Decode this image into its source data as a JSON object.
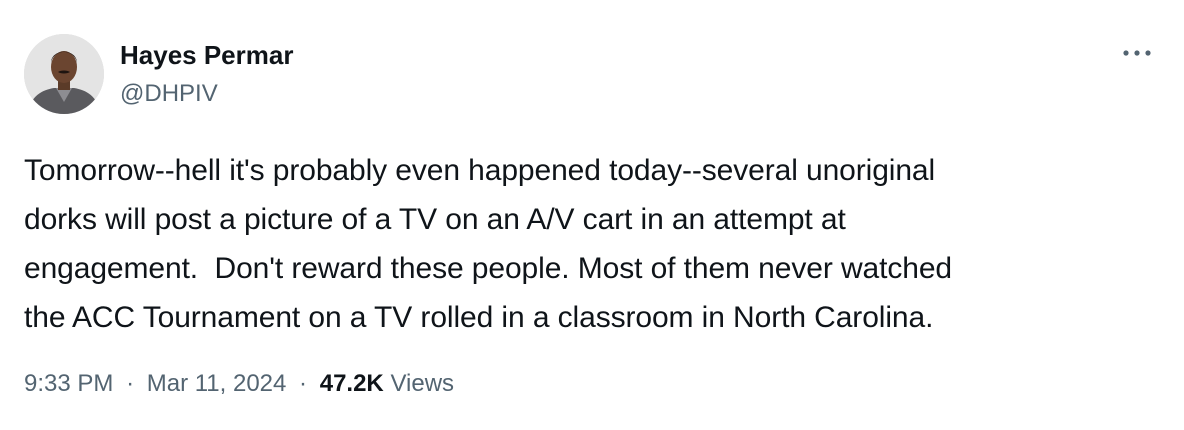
{
  "author": {
    "display_name": "Hayes Permar",
    "handle": "@DHPIV"
  },
  "tweet": {
    "lines": [
      "Tomorrow--hell it's probably even happened today--several unoriginal",
      "dorks will post a picture of a TV on an A/V cart in an attempt at",
      "engagement.  Don't reward these people. Most of them never watched",
      "the ACC Tournament on a TV rolled in a classroom in North Carolina."
    ]
  },
  "meta": {
    "time": "9:33 PM",
    "separator": "·",
    "date": "Mar 11, 2024",
    "views_count": "47.2K",
    "views_label": "Views"
  },
  "icons": {
    "more": "more-horizontal-icon",
    "avatar": "profile-photo"
  },
  "colors": {
    "text_primary": "#0f1419",
    "text_secondary": "#536471",
    "background": "#ffffff"
  }
}
